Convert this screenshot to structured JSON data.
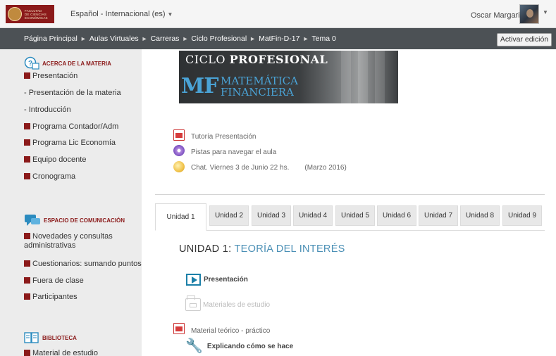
{
  "header": {
    "logo_text": "FACULTAD\nDE CIENCIAS\nECONÓMICAS",
    "language": "Español - Internacional (es)",
    "username": "Oscar Margaria"
  },
  "nav": {
    "breadcrumbs": [
      "Página Principal",
      "Aulas Virtuales",
      "Carreras",
      "Ciclo Profesional",
      "MatFin-D-17",
      "Tema 0"
    ],
    "separator": "►",
    "edit_button": "Activar edición"
  },
  "sidebar": {
    "acerca": {
      "heading": "ACERCA DE LA MATERIA",
      "items": [
        "Presentación",
        "- Presentación de la materia",
        "- Introducción",
        "Programa Contador/Adm",
        "Programa Lic Economía",
        "Equipo docente",
        "Cronograma"
      ]
    },
    "espacio": {
      "heading": "ESPACIO DE COMUNICACIÓN",
      "items": [
        "Novedades y consultas administrativas",
        "Cuestionarios: sumando puntos",
        "Fuera de clase",
        "Participantes"
      ]
    },
    "biblioteca": {
      "heading": "BIBLIOTECA",
      "items": [
        "Material de estudio"
      ]
    }
  },
  "banner": {
    "line1_a": "CICLO ",
    "line1_b": "PROFESIONAL",
    "mf": "MF",
    "line2_a": "MATEMÁTICA",
    "line2_b": "FINANCIERA"
  },
  "activities": {
    "tutoria": "Tutoría Presentación",
    "pistas": "Pistas para navegar el aula",
    "chat": "Chat. Viernes 3 de Junio 22 hs.",
    "chat_note": "(Marzo 2016)"
  },
  "tabs": [
    "Unidad 1",
    "Unidad 2",
    "Unidad 3",
    "Unidad 4",
    "Unidad 5",
    "Unidad 6",
    "Unidad 7",
    "Unidad 8",
    "Unidad 9"
  ],
  "unit": {
    "prefix": "UNIDAD 1: ",
    "title": "TEORÍA DEL INTERÉS",
    "resources": {
      "presentacion": "Presentación",
      "materiales": "Materiales de estudio",
      "material_teorico": "Material teórico - práctico",
      "explicando": "Explicando cómo se hace"
    }
  },
  "colors": {
    "brand": "#8b1a1a",
    "navbar": "#4c5155",
    "sidebar_bg": "#ececec",
    "accent_blue": "#4a8fb5"
  }
}
